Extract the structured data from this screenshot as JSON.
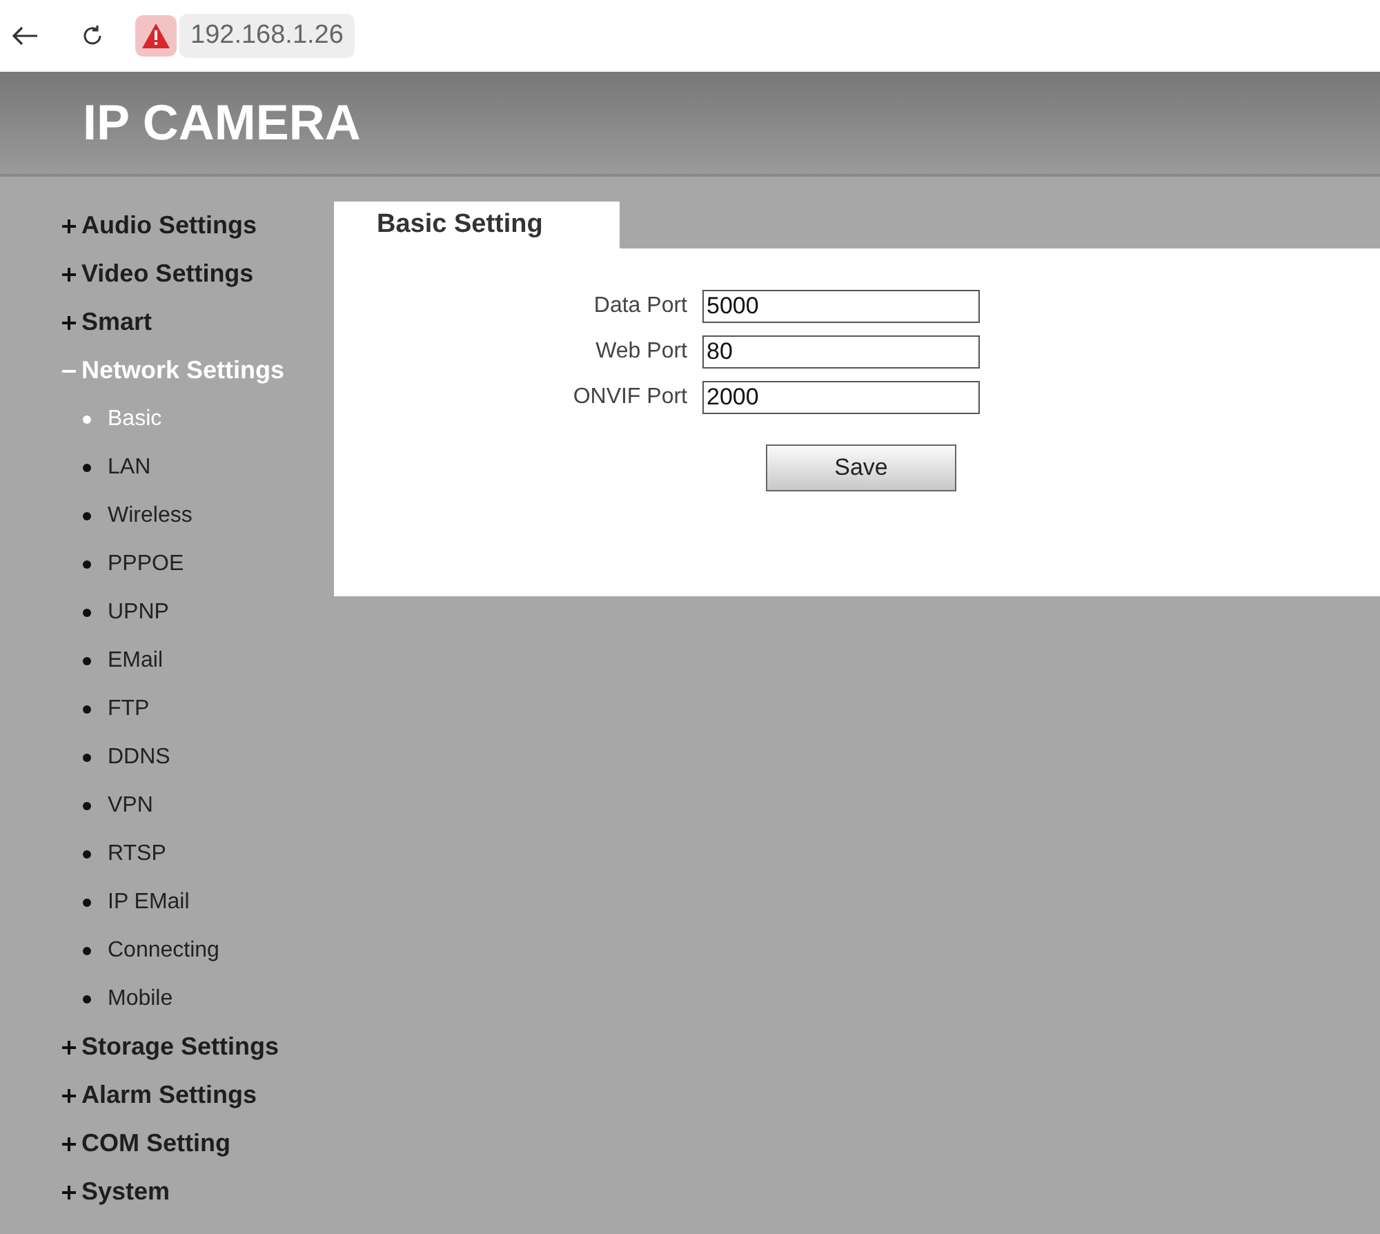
{
  "browser": {
    "address": "192.168.1.26"
  },
  "header": {
    "title": "IP CAMERA"
  },
  "sidebar": {
    "sections": [
      {
        "label": "Audio Settings",
        "expanded": false
      },
      {
        "label": "Video Settings",
        "expanded": false
      },
      {
        "label": "Smart",
        "expanded": false
      },
      {
        "label": "Network Settings",
        "expanded": true,
        "children": [
          {
            "label": "Basic",
            "selected": true
          },
          {
            "label": "LAN",
            "selected": false
          },
          {
            "label": "Wireless",
            "selected": false
          },
          {
            "label": "PPPOE",
            "selected": false
          },
          {
            "label": "UPNP",
            "selected": false
          },
          {
            "label": "EMail",
            "selected": false
          },
          {
            "label": "FTP",
            "selected": false
          },
          {
            "label": "DDNS",
            "selected": false
          },
          {
            "label": "VPN",
            "selected": false
          },
          {
            "label": "RTSP",
            "selected": false
          },
          {
            "label": "IP EMail",
            "selected": false
          },
          {
            "label": "Connecting",
            "selected": false
          },
          {
            "label": "Mobile",
            "selected": false
          }
        ]
      },
      {
        "label": "Storage Settings",
        "expanded": false
      },
      {
        "label": "Alarm Settings",
        "expanded": false
      },
      {
        "label": "COM Setting",
        "expanded": false
      },
      {
        "label": "System",
        "expanded": false
      }
    ]
  },
  "panel": {
    "tab": "Basic Setting",
    "fields": [
      {
        "label": "Data Port",
        "value": "5000"
      },
      {
        "label": "Web Port",
        "value": "80"
      },
      {
        "label": "ONVIF Port",
        "value": "2000"
      }
    ],
    "button": "Save"
  }
}
